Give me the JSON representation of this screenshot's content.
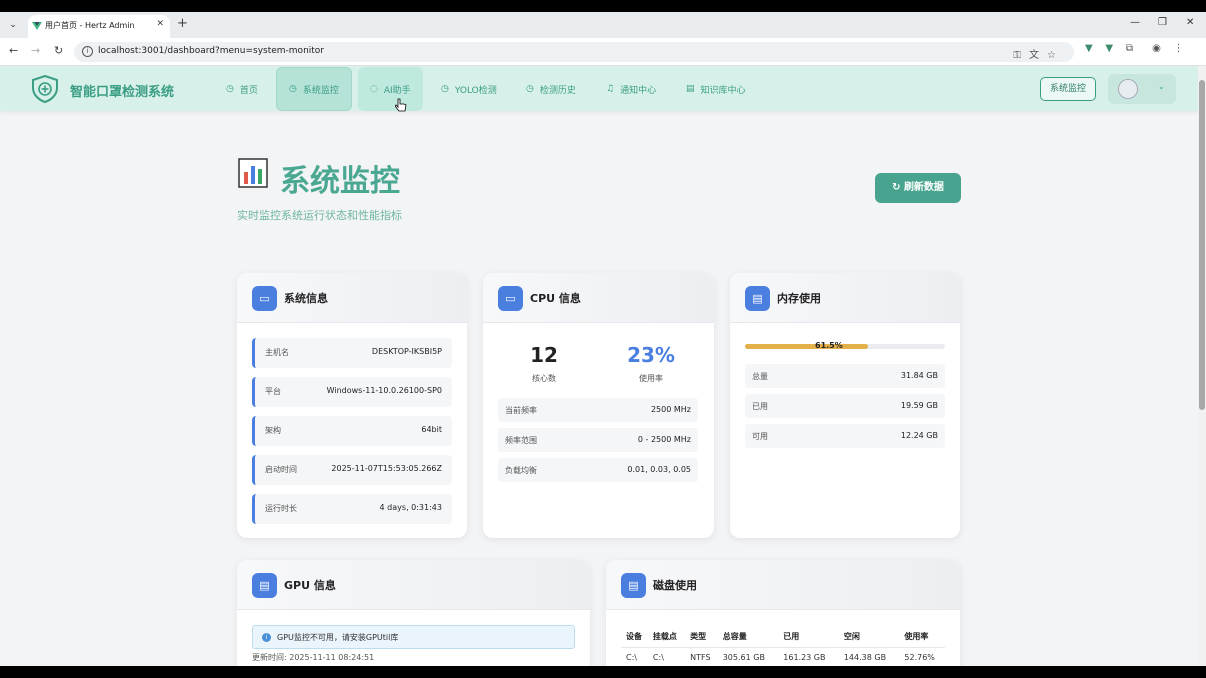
{
  "browser": {
    "tab_title": "用户首页 - Hertz Admin",
    "url": "localhost:3001/dashboard?menu=system-monitor"
  },
  "header": {
    "brand": "智能口罩检测系统",
    "nav": [
      {
        "label": "首页",
        "icon": "home-icon",
        "state": "normal"
      },
      {
        "label": "系统监控",
        "icon": "monitor-icon",
        "state": "active"
      },
      {
        "label": "AI助手",
        "icon": "chat-icon",
        "state": "hover"
      },
      {
        "label": "YOLO检测",
        "icon": "detect-icon",
        "state": "normal"
      },
      {
        "label": "检测历史",
        "icon": "history-icon",
        "state": "normal"
      },
      {
        "label": "通知中心",
        "icon": "bell-icon",
        "state": "normal"
      },
      {
        "label": "知识库中心",
        "icon": "book-icon",
        "state": "normal"
      }
    ],
    "right_button": "系统监控"
  },
  "page": {
    "title": "系统监控",
    "subtitle": "实时监控系统运行状态和性能指标",
    "refresh_button": "刷新数据"
  },
  "system_info": {
    "title": "系统信息",
    "rows": [
      {
        "key": "主机名",
        "value": "DESKTOP-IKSBI5P"
      },
      {
        "key": "平台",
        "value": "Windows-11-10.0.26100-SP0"
      },
      {
        "key": "架构",
        "value": "64bit"
      },
      {
        "key": "启动时间",
        "value": "2025-11-07T15:53:05.266Z"
      },
      {
        "key": "运行时长",
        "value": "4 days, 0:31:43"
      }
    ]
  },
  "cpu_info": {
    "title": "CPU 信息",
    "cores": "12",
    "cores_label": "核心数",
    "usage": "23%",
    "usage_label": "使用率",
    "rows": [
      {
        "key": "当前频率",
        "value": "2500 MHz"
      },
      {
        "key": "频率范围",
        "value": "0 - 2500 MHz"
      },
      {
        "key": "负载均衡",
        "value": "0.01, 0.03, 0.05"
      }
    ]
  },
  "memory": {
    "title": "内存使用",
    "percent_label": "61.5%",
    "percent": 61.5,
    "rows": [
      {
        "key": "总量",
        "value": "31.84 GB"
      },
      {
        "key": "已用",
        "value": "19.59 GB"
      },
      {
        "key": "可用",
        "value": "12.24 GB"
      }
    ]
  },
  "gpu": {
    "title": "GPU 信息",
    "alert": "GPU监控不可用，请安装GPUtil库",
    "updated": "更新时间: 2025-11-11 08:24:51"
  },
  "disk": {
    "title": "磁盘使用",
    "headers": [
      "设备",
      "挂载点",
      "类型",
      "总容量",
      "已用",
      "空闲",
      "使用率"
    ],
    "rows": [
      [
        "C:\\",
        "C:\\",
        "NTFS",
        "305.61 GB",
        "161.23 GB",
        "144.38 GB",
        "52.76%"
      ]
    ]
  },
  "colors": {
    "accent": "#3a9e84",
    "card_icon": "#4a7fe0",
    "memory_bar": "#e4b04a"
  }
}
